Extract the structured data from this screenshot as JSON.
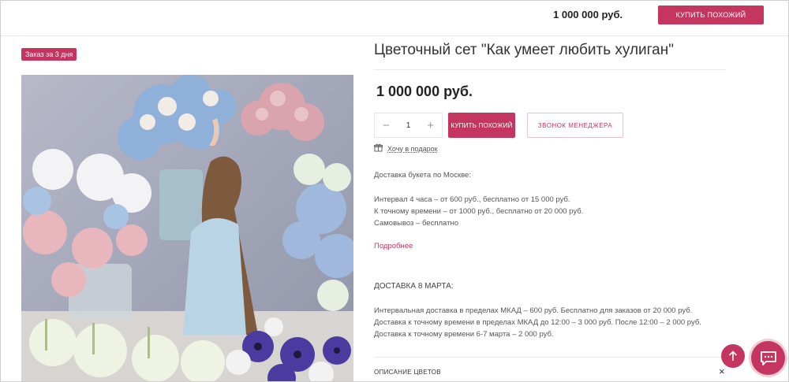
{
  "topbar": {
    "price": "1 000 000 руб.",
    "buy_label": "КУПИТЬ ПОХОЖИЙ"
  },
  "product": {
    "badge": "Заказ за 3 дня",
    "title": "Цветочный сет \"Как умеет любить хулиган\"",
    "price": "1 000 000 руб.",
    "photo_icon": "bouquet-photo"
  },
  "actions": {
    "qty_minus": "−",
    "qty_value": "1",
    "qty_plus": "+",
    "buy_label": "КУПИТЬ ПОХОЖИЙ",
    "call_label": "ЗВОНОК МЕНЕДЖЕРА",
    "gift_label": "Хочу в подарок"
  },
  "delivery": {
    "heading": "Доставка букета по Москве:",
    "lines": [
      "Интервал 4 часа – от 600 руб., бесплатно от 15 000 руб.",
      "К точному времени – от 1000 руб., бесплатно от 20 000 руб.",
      "Самовывоз – бесплатно"
    ],
    "more": "Подробнее"
  },
  "march": {
    "heading": "ДОСТАВКА 8 МАРТА:",
    "lines": [
      "Интервальная доставка в пределах МКАД – 600 руб. Бесплатно для заказов от 20 000 руб.",
      "Доставка к точному времени  в пределах МКАД  до 12:00 – 3 000 руб. После 12:00 – 2 000 руб.",
      "Доставка к точному времени 6-7 марта – 2 000 руб."
    ]
  },
  "accordion": {
    "title": "ОПИСАНИЕ ЦВЕТОВ",
    "close": "×"
  },
  "colors": {
    "accent": "#c4365f",
    "text": "#333333",
    "muted": "#555555"
  }
}
